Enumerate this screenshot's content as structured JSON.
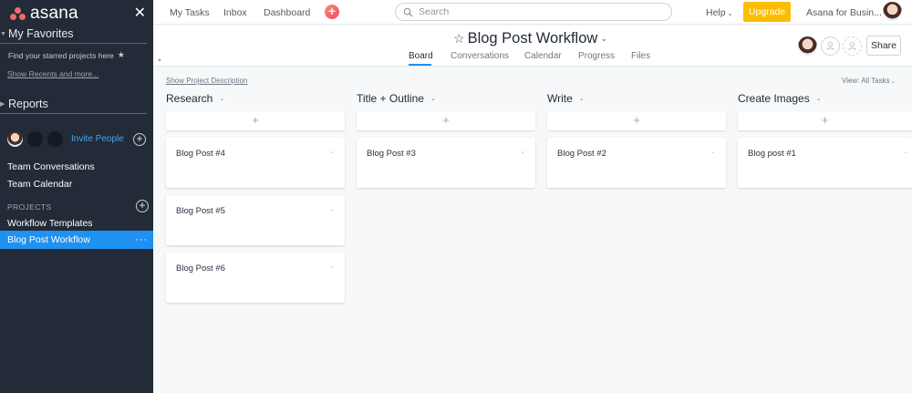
{
  "sidebar": {
    "logo_text": "asana",
    "favorites_title": "My Favorites",
    "favorites_hint": "Find your starred projects here",
    "show_recents": "Show Recents and more...",
    "reports_title": "Reports",
    "invite_label": "Invite People",
    "team_conversations": "Team Conversations",
    "team_calendar": "Team Calendar",
    "projects_label": "PROJECTS",
    "projects": [
      {
        "label": "Workflow Templates"
      },
      {
        "label": "Blog Post Workflow",
        "active": true
      }
    ],
    "active_more": "···"
  },
  "topbar": {
    "links": [
      "My Tasks",
      "Inbox",
      "Dashboard"
    ],
    "search_placeholder": "Search",
    "help": "Help",
    "upgrade": "Upgrade",
    "workspace": "Asana for Busin..."
  },
  "project": {
    "title": "Blog Post Workflow",
    "tabs": [
      {
        "label": "Board",
        "active": true
      },
      {
        "label": "Conversations"
      },
      {
        "label": "Calendar"
      },
      {
        "label": "Progress"
      },
      {
        "label": "Files"
      }
    ],
    "share": "Share"
  },
  "board": {
    "show_description": "Show Project Description",
    "view_label": "View: All Tasks",
    "columns": [
      {
        "title": "Research",
        "cards": [
          "Blog Post #4",
          "Blog Post #5",
          "Blog Post #6"
        ]
      },
      {
        "title": "Title + Outline",
        "cards": [
          "Blog Post #3"
        ]
      },
      {
        "title": "Write",
        "cards": [
          "Blog Post #2"
        ]
      },
      {
        "title": "Create Images",
        "cards": [
          "Blog post #1"
        ]
      }
    ]
  },
  "colors": {
    "sidebar_bg": "#222b37",
    "accent_blue": "#1f91f0",
    "upgrade_yellow": "#fcbd01",
    "board_bg": "#f6f8f9",
    "logo_coral": "#f06a6a"
  },
  "icons": [
    "asana-logo-icon",
    "close-icon",
    "star-icon",
    "plus-icon",
    "search-icon",
    "chevron-down-icon",
    "user-icon",
    "avatar"
  ]
}
